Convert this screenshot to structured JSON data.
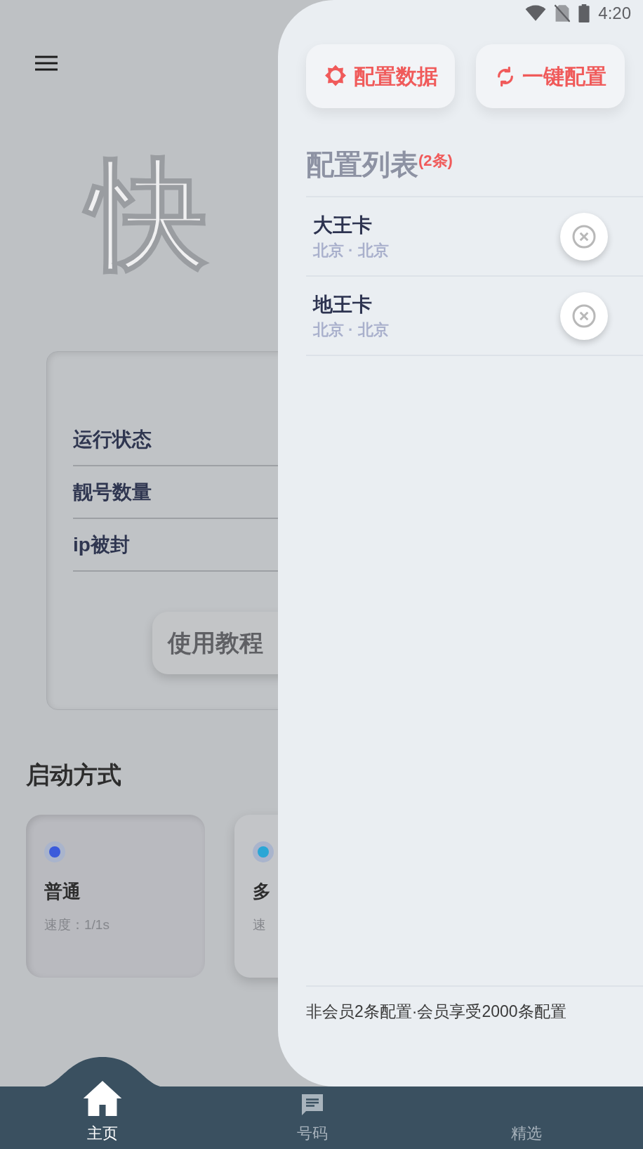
{
  "status_bar": {
    "time": "4:20"
  },
  "home": {
    "title": "快",
    "stats": [
      "运行状态",
      "靓号数量",
      "ip被封"
    ],
    "tutorial_button": "使用教程",
    "start_heading": "启动方式",
    "modes": [
      {
        "name": "普通",
        "speed": "速度：1/1s",
        "color": "#3b5bdb",
        "selected": true
      },
      {
        "name": "多",
        "speed": "速",
        "color": "#2aa6d6",
        "selected": false
      }
    ]
  },
  "drawer": {
    "buttons": [
      {
        "label": "配置数据",
        "kind": "gear"
      },
      {
        "label": "一键配置",
        "kind": "sync"
      }
    ],
    "list_title": "配置列表",
    "list_count": "(2条)",
    "items": [
      {
        "name": "大王卡",
        "location": "北京 · 北京"
      },
      {
        "name": "地王卡",
        "location": "北京 · 北京"
      }
    ],
    "footer": "非会员2条配置·会员享受2000条配置"
  },
  "nav": [
    {
      "label": "主页",
      "selected": true
    },
    {
      "label": "号码",
      "selected": false
    },
    {
      "label": "精选",
      "selected": false
    }
  ]
}
